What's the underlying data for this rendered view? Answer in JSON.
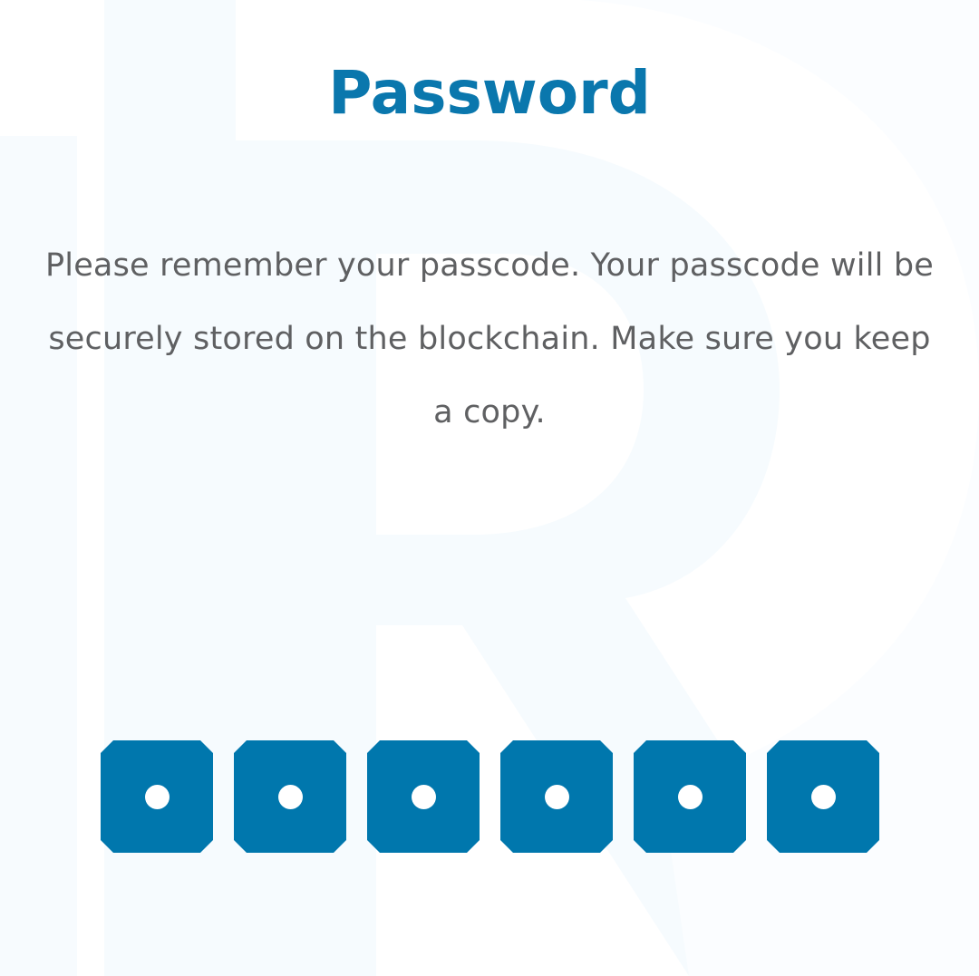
{
  "screen": {
    "title": "Password",
    "message": "Please remember your passcode. Your passcode will be securely stored on the blockchain. Make sure you keep a copy."
  },
  "passcode": {
    "length": 6,
    "filled": 6,
    "box_color": "#0077ad",
    "dot_color": "#ffffff"
  },
  "colors": {
    "title": "#0a77ad",
    "message": "#5f6062",
    "background": "#ffffff",
    "watermark": "#f6fbfe"
  },
  "icons": {
    "background_watermark": "brand-logo-watermark",
    "filled_digit": "filled-dot-icon"
  }
}
